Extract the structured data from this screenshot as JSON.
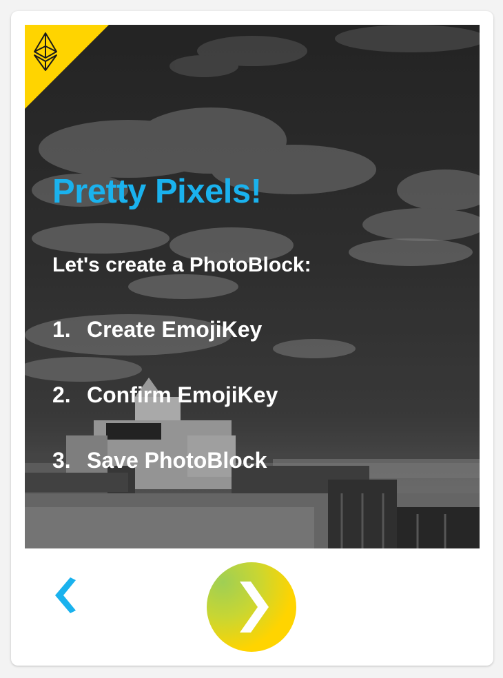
{
  "colors": {
    "accent_blue": "#1ab2ee",
    "accent_yellow": "#ffd400",
    "card_background": "#ffffff",
    "text_light": "#ffffff"
  },
  "icons": {
    "corner": "ethereum-icon",
    "back": "chevron-left-icon",
    "next": "chevron-right-icon"
  },
  "intro": {
    "title": "Pretty Pixels!",
    "subtitle": "Let's create a PhotoBlock:",
    "steps": [
      {
        "number": "1.",
        "label": "Create EmojiKey"
      },
      {
        "number": "2.",
        "label": "Confirm EmojiKey"
      },
      {
        "number": "3.",
        "label": "Save PhotoBlock"
      }
    ]
  }
}
